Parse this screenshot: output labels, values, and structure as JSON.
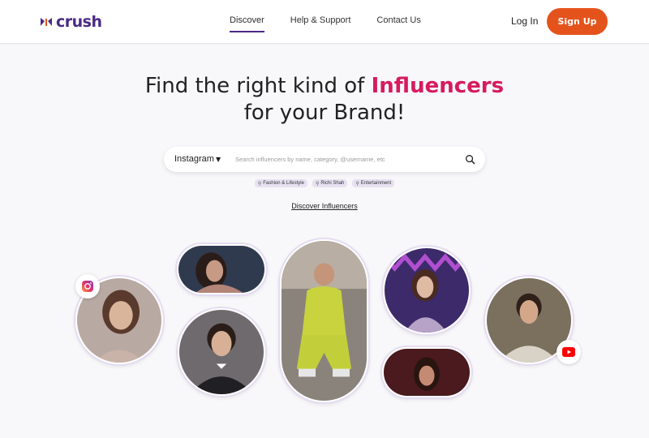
{
  "brand": {
    "name": "crush"
  },
  "nav": {
    "links": [
      "Discover",
      "Help & Support",
      "Contact Us"
    ],
    "login": "Log In",
    "signup": "Sign Up"
  },
  "hero": {
    "line1_prefix": "Find the right kind of ",
    "line1_highlight": "Influencers",
    "line2": "for your Brand!"
  },
  "search": {
    "platform": "Instagram",
    "placeholder": "Search influencers by name, category, @username, etc"
  },
  "chips": [
    "Fashion & Lifestyle",
    "Richi Shah",
    "Entertainment"
  ],
  "discover_link": "Discover Influencers",
  "colors": {
    "brand_purple": "#4b2a86",
    "accent_orange": "#e4531c",
    "highlight_pink": "#d61b5e",
    "chip_bg": "#e7e1f2"
  },
  "icons": [
    "crush-logo-icon",
    "chevron-down-icon",
    "search-icon",
    "instagram-icon",
    "youtube-icon"
  ]
}
